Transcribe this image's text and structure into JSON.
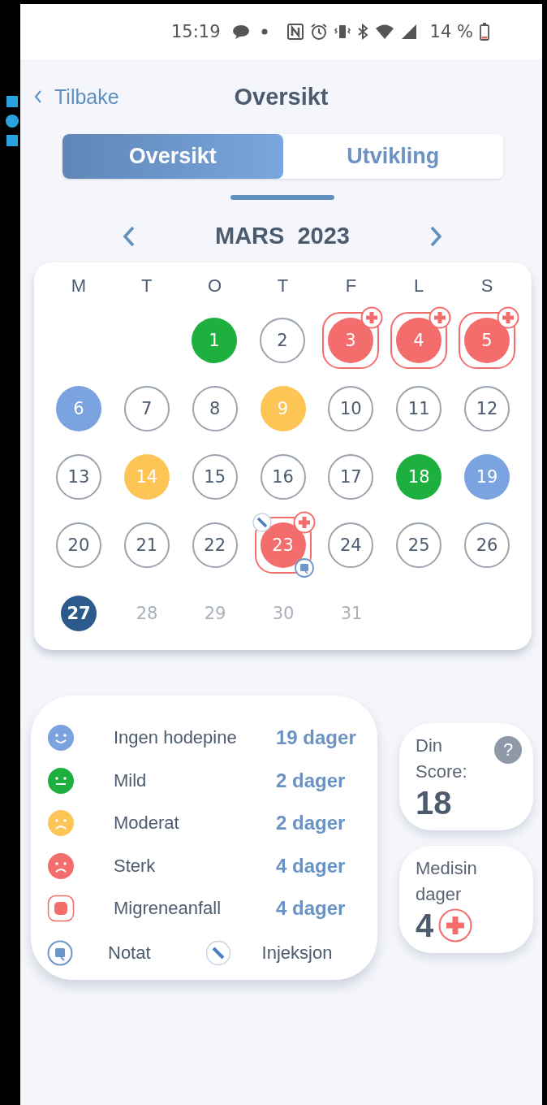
{
  "status_bar": {
    "time": "15:19",
    "battery": "14 %"
  },
  "header": {
    "back": "Tilbake",
    "title": "Oversikt"
  },
  "tabs": [
    {
      "label": "Oversikt",
      "selected": true
    },
    {
      "label": "Utvikling",
      "selected": false
    }
  ],
  "calendar": {
    "month": "MARS 2023",
    "weekdays": [
      "M",
      "T",
      "O",
      "T",
      "F",
      "L",
      "S"
    ],
    "weeks": [
      [
        {
          "number": "1",
          "kind": "mild"
        },
        {
          "number": "2",
          "kind": "unlogged"
        },
        {
          "number": "3",
          "kind": "migraine",
          "medicine": true
        },
        {
          "number": "4",
          "kind": "migraine",
          "medicine": true
        },
        {
          "number": "5",
          "kind": "migraine",
          "medicine": true
        }
      ],
      [
        {
          "number": "6",
          "kind": "none"
        },
        {
          "number": "7",
          "kind": "unlogged"
        },
        {
          "number": "8",
          "kind": "unlogged"
        },
        {
          "number": "9",
          "kind": "moderate"
        },
        {
          "number": "10",
          "kind": "unlogged"
        },
        {
          "number": "11",
          "kind": "unlogged"
        },
        {
          "number": "12",
          "kind": "unlogged"
        }
      ],
      [
        {
          "number": "13",
          "kind": "unlogged"
        },
        {
          "number": "14",
          "kind": "moderate"
        },
        {
          "number": "15",
          "kind": "unlogged"
        },
        {
          "number": "16",
          "kind": "unlogged"
        },
        {
          "number": "17",
          "kind": "unlogged"
        },
        {
          "number": "18",
          "kind": "mild"
        },
        {
          "number": "19",
          "kind": "none"
        }
      ],
      [
        {
          "number": "20",
          "kind": "unlogged"
        },
        {
          "number": "21",
          "kind": "unlogged"
        },
        {
          "number": "22",
          "kind": "unlogged"
        },
        {
          "number": "23",
          "kind": "migraine",
          "medicine": true,
          "injection": true,
          "note": true
        },
        {
          "number": "24",
          "kind": "unlogged"
        },
        {
          "number": "25",
          "kind": "unlogged"
        },
        {
          "number": "26",
          "kind": "unlogged"
        }
      ],
      [
        {
          "number": "27",
          "kind": "today"
        },
        {
          "number": "28",
          "kind": "future"
        },
        {
          "number": "29",
          "kind": "future"
        },
        {
          "number": "30",
          "kind": "future"
        },
        {
          "number": "31",
          "kind": "future"
        }
      ]
    ]
  },
  "legend": {
    "items": [
      {
        "kind": "none",
        "label": "Ingen hodepine",
        "count": "19 dager",
        "color": "#7ba3df"
      },
      {
        "kind": "mild",
        "label": "Mild",
        "count": "2 dager",
        "color": "#1db03f"
      },
      {
        "kind": "moderate",
        "label": "Moderat",
        "count": "2 dager",
        "color": "#fcc555"
      },
      {
        "kind": "strong",
        "label": "Sterk",
        "count": "4 dager",
        "color": "#f36d6d"
      },
      {
        "kind": "migraine",
        "label": "Migreneanfall",
        "count": "4 dager",
        "color": "#f36d6d"
      }
    ],
    "marks": [
      {
        "kind": "note",
        "label": "Notat"
      },
      {
        "kind": "injection",
        "label": "Injeksjon"
      }
    ]
  },
  "score": {
    "label": "Din Score:",
    "value": "18",
    "help": "?"
  },
  "medicine": {
    "label": "Medisin dager",
    "value": "4"
  }
}
